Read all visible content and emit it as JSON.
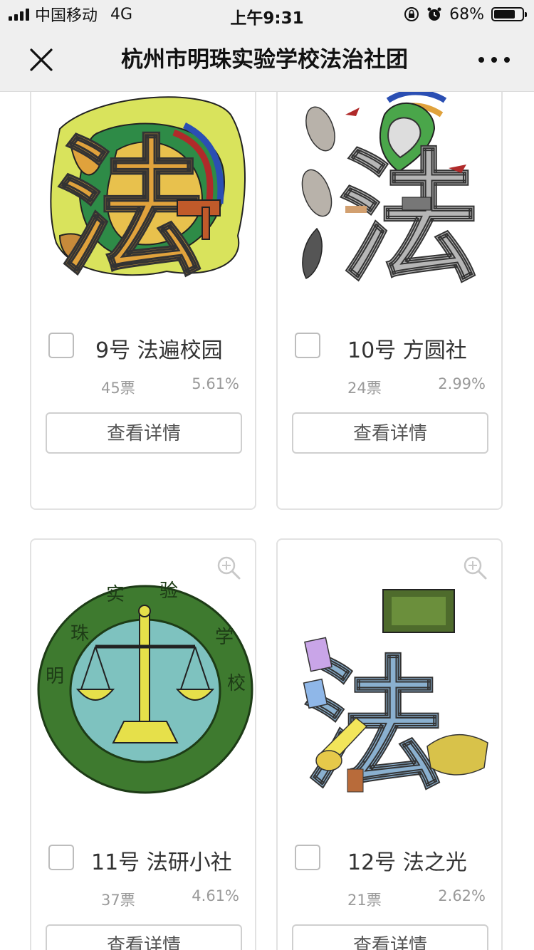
{
  "status_bar": {
    "carrier": "中国移动",
    "network": "4G",
    "time": "上午9:31",
    "battery_pct": "68%",
    "battery_level": 0.68
  },
  "nav": {
    "title": "杭州市明珠实验学校法治社团",
    "close_icon": "close-icon",
    "more_icon": "more-icon"
  },
  "cards": [
    {
      "name": "9号 法遍校园",
      "votes": "45票",
      "pct": "5.61%",
      "button": "查看详情",
      "selected": false
    },
    {
      "name": "10号 方圆社",
      "votes": "24票",
      "pct": "2.99%",
      "button": "查看详情",
      "selected": false
    },
    {
      "name": "11号 法研小社",
      "votes": "37票",
      "pct": "4.61%",
      "button": "查看详情",
      "selected": false
    },
    {
      "name": "12号 法之光",
      "votes": "21票",
      "pct": "2.62%",
      "button": "查看详情",
      "selected": false
    }
  ],
  "card_images": {
    "card_9_text": "法",
    "card_10_text": "法",
    "card_11_ring_text": [
      "明",
      "珠",
      "实",
      "验",
      "学",
      "校"
    ],
    "card_12_text": "法"
  },
  "colors": {
    "bar_bg": "#efefef",
    "card_border": "#e2e2e2",
    "text_muted": "#9a9a9a"
  }
}
